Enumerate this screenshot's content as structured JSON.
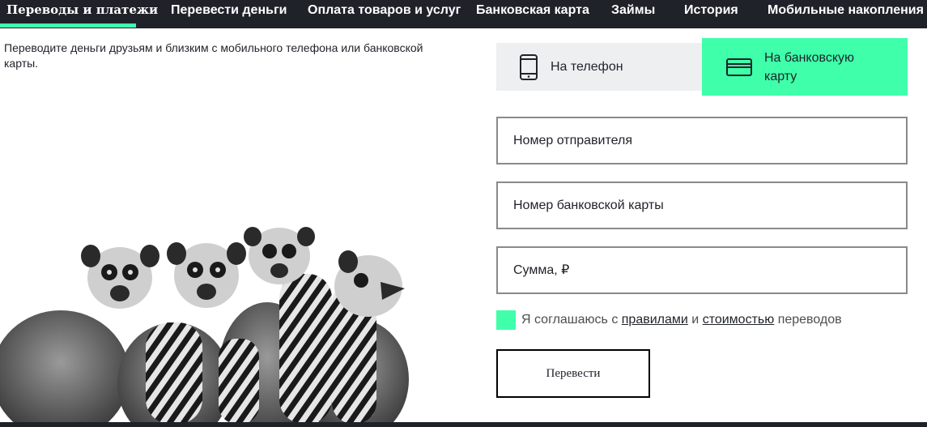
{
  "nav": {
    "items": [
      {
        "label": "Переводы и платежи",
        "active": true
      },
      {
        "label": "Перевести деньги"
      },
      {
        "label": "Оплата товаров и услуг"
      },
      {
        "label": "Банковская карта"
      },
      {
        "label": "Займы"
      },
      {
        "label": "История"
      },
      {
        "label": "Мобильные накопления"
      }
    ]
  },
  "intro": {
    "text": "Переводите деньги друзьям и близким с мобильного телефона или банковской карты."
  },
  "transfer": {
    "tabs": [
      {
        "label": "На телефон",
        "icon": "smartphone-icon"
      },
      {
        "label": "На банковскую карту",
        "icon": "credit-card-icon",
        "selected": true
      }
    ],
    "sender_placeholder": "Номер отправителя",
    "card_placeholder": "Номер банковской карты",
    "amount_placeholder": "Сумма, ₽",
    "agree": {
      "prefix": "Я соглашаюсь с",
      "rules_link": "правилами",
      "and": "и",
      "cost_link": "стоимостью",
      "suffix": "переводов"
    },
    "submit_label": "Перевести"
  },
  "colors": {
    "accent": "#3fffaa",
    "nav_bg": "#1f2229",
    "tab_inactive": "#eeeff1",
    "border": "#8a8a8a"
  }
}
